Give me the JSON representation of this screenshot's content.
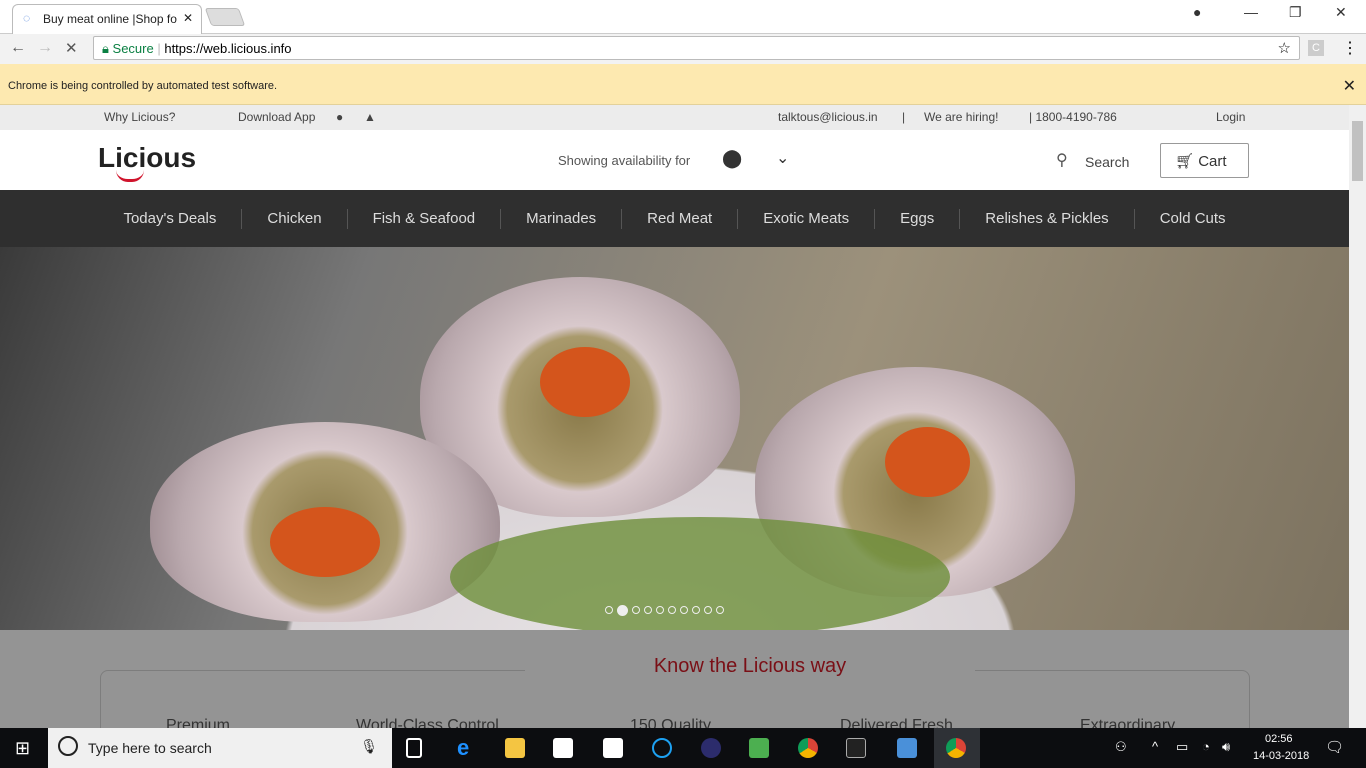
{
  "browser": {
    "tab_title": "Buy meat online |Shop fo",
    "secure_label": "Secure",
    "url": "https://web.licious.info",
    "infobar": "Chrome is being controlled by automated test software.",
    "profile_letter": "C"
  },
  "topstrip": {
    "why": "Why Licious?",
    "download": "Download App",
    "email": "talktous@licious.in",
    "hiring": "We are hiring!",
    "phone": "| 1800-4190-786",
    "login": "Login"
  },
  "header": {
    "logo": "Licious",
    "availability": "Showing availability for",
    "search": "Search",
    "cart": "Cart"
  },
  "nav": [
    "Today's Deals",
    "Chicken",
    "Fish & Seafood",
    "Marinades",
    "Red Meat",
    "Exotic Meats",
    "Eggs",
    "Relishes & Pickles",
    "Cold Cuts"
  ],
  "carousel": {
    "slides": 10,
    "active": 2
  },
  "section": {
    "title": "Know the Licious way",
    "features": [
      "Premium",
      "World-Class Control",
      "150 Quality",
      "Delivered Fresh",
      "Extraordinary"
    ]
  },
  "taskbar": {
    "search_placeholder": "Type here to search",
    "time": "02:56",
    "date": "14-03-2018"
  },
  "colors": {
    "brand": "#d0142c",
    "title": "#7a0f16",
    "nav_bg": "#2f2f2f"
  }
}
